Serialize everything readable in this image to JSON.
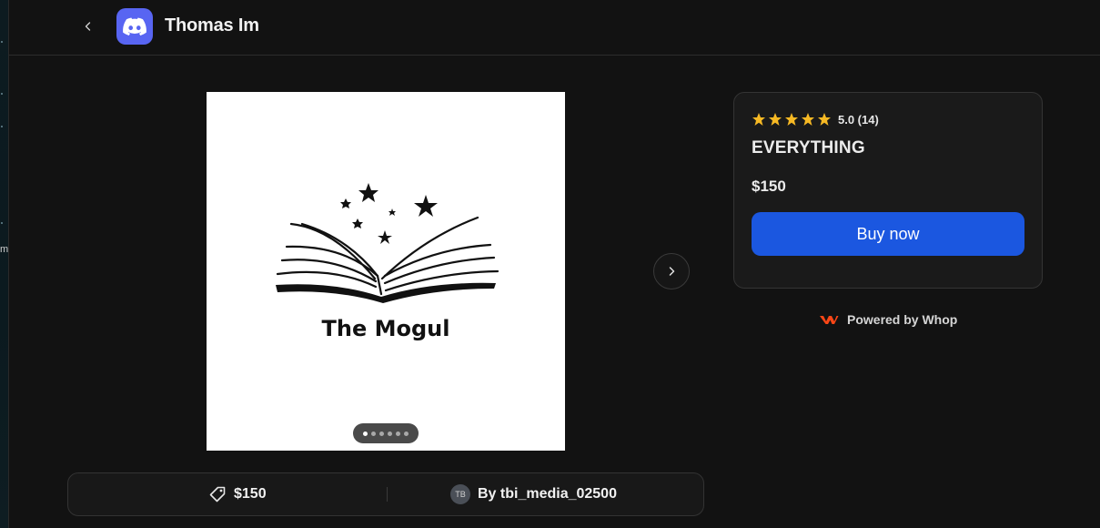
{
  "sidebar_fragment": {
    "glyph": "m"
  },
  "header": {
    "app_icon": "discord-logo-icon",
    "back_icon": "chevron-left-icon",
    "title": "Thomas Im"
  },
  "gallery": {
    "image_text": "The Mogul",
    "image_icon": "open-book-with-stars-icon",
    "slide_count": 6,
    "active_slide": 1,
    "next_icon": "chevron-right-icon"
  },
  "info_bar": {
    "price_icon": "tag-icon",
    "price": "$150",
    "seller_avatar": "TB",
    "seller": "By tbi_media_02500"
  },
  "product": {
    "rating": "5.0 (14)",
    "stars": 5,
    "title": "EVERYTHING",
    "price": "$150",
    "buy_label": "Buy now"
  },
  "footer": {
    "powered_by": "Powered by Whop",
    "logo_icon": "whop-logo-icon"
  },
  "colors": {
    "background": "#121212",
    "card": "#1a1a1a",
    "accent_button": "#1b57e0",
    "star": "#f7b924",
    "discord": "#5865f2",
    "whop": "#fa4616"
  }
}
